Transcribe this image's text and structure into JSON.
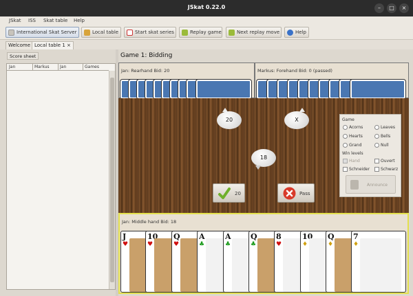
{
  "window": {
    "title": "JSkat 0.22.0",
    "controls": [
      "–",
      "□",
      "×"
    ]
  },
  "menu": [
    "JSkat",
    "ISS",
    "Skat table",
    "Help"
  ],
  "toolbar": [
    {
      "label": "International Skat Server",
      "icon": "network-icon"
    },
    {
      "label": "Local table",
      "icon": "table-icon"
    },
    {
      "label": "Start skat series",
      "icon": "cards-icon"
    },
    {
      "label": "Replay game",
      "icon": "replay-icon"
    },
    {
      "label": "Next replay move",
      "icon": "next-icon"
    },
    {
      "label": "Help",
      "icon": "help-icon"
    }
  ],
  "tabs": [
    {
      "label": "Welcome"
    },
    {
      "label": "Local table 1",
      "close": "×"
    }
  ],
  "score_sheet": {
    "tab_label": "Score sheet",
    "columns": [
      "Jan",
      "Markus",
      "Jan",
      "Games"
    ]
  },
  "game": {
    "title": "Game 1: Bidding",
    "left_opponent": {
      "label": "Jan: Rearhand Bid: 20",
      "cards": 10
    },
    "right_opponent": {
      "label": "Markus: Forehand Bid: 0 (passed)",
      "cards": 10
    },
    "bubbles": {
      "left": "20",
      "right": "X",
      "bottom": "18"
    },
    "bid_button": "20",
    "pass_button": "Pass",
    "player": {
      "label": "Jan: Middle hand Bid: 18",
      "cards": [
        {
          "rank": "J",
          "suit": "♥",
          "suit_color": "#d01010"
        },
        {
          "rank": "10",
          "suit": "♥",
          "suit_color": "#d01010"
        },
        {
          "rank": "Q",
          "suit": "♥",
          "suit_color": "#d01010"
        },
        {
          "rank": "A",
          "suit": "♣",
          "suit_color": "#1a9a1a"
        },
        {
          "rank": "A",
          "suit": "♣",
          "suit_color": "#1a9a1a"
        },
        {
          "rank": "Q",
          "suit": "♣",
          "suit_color": "#1a9a1a"
        },
        {
          "rank": "8",
          "suit": "♥",
          "suit_color": "#d01010"
        },
        {
          "rank": "10",
          "suit": "♦",
          "suit_color": "#d0a010"
        },
        {
          "rank": "Q",
          "suit": "♦",
          "suit_color": "#d0a010"
        },
        {
          "rank": "7",
          "suit": "♦",
          "suit_color": "#d0a010"
        }
      ]
    }
  },
  "game_panel": {
    "game_label": "Game",
    "games": [
      "Acorns",
      "Leaves",
      "Hearts",
      "Bells",
      "Grand",
      "Null"
    ],
    "win_levels_label": "Win levels",
    "hand": "Hand",
    "ouvert": "Ouvert",
    "schneider": "Schneider",
    "schwarz": "Schwarz",
    "announce": "Announce"
  }
}
